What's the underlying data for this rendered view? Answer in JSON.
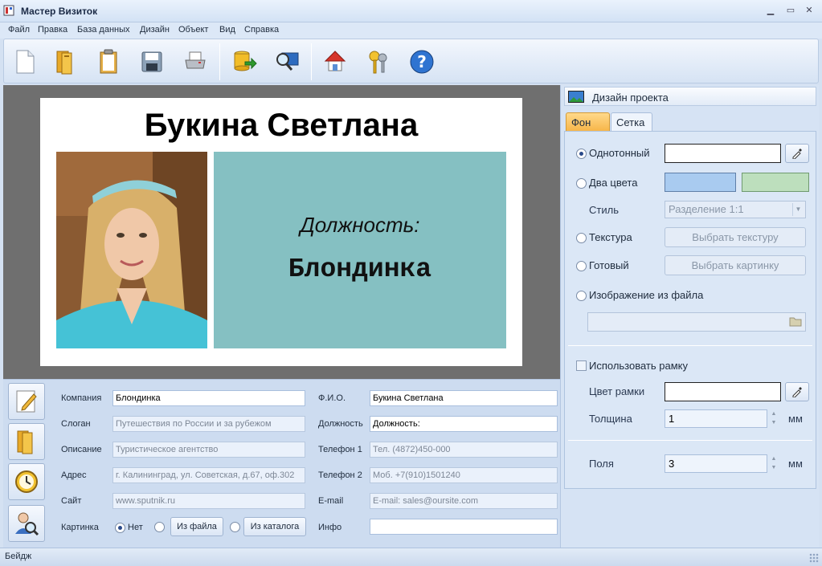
{
  "window": {
    "title": "Мастер Визиток"
  },
  "menu": [
    "Файл",
    "Правка",
    "База данных",
    "Дизайн",
    "Объект",
    "Вид",
    "Справка"
  ],
  "toolbar": {
    "icons": [
      "new-document-icon",
      "open-folder-icon",
      "clipboard-icon",
      "save-icon",
      "print-icon",
      "database-export-icon",
      "preview-monitor-icon",
      "home-icon",
      "keys-icon",
      "help-icon"
    ]
  },
  "card": {
    "name": "Букина Светлана",
    "position_label": "Должность:",
    "position_value": "Блондинка",
    "background": "#85c0c2"
  },
  "form": {
    "labels": {
      "company": "Компания",
      "slogan": "Слоган",
      "description": "Описание",
      "address": "Адрес",
      "site": "Сайт",
      "picture": "Картинка",
      "fio": "Ф.И.О.",
      "position": "Должность",
      "phone1": "Телефон 1",
      "phone2": "Телефон 2",
      "email": "E-mail",
      "info": "Инфо"
    },
    "values": {
      "company": "Блондинка",
      "slogan": "Путешествия по России и за рубежом",
      "description": "Туристическое агентство",
      "address": "г. Калининград, ул. Советская, д.67, оф.302",
      "site": "www.sputnik.ru",
      "fio": "Букина Светлана",
      "position": "Должность:",
      "phone1": "Тел. (4872)450-000",
      "phone2": "Моб. +7(910)1501240",
      "email": "E-mail: sales@oursite.com",
      "info": ""
    },
    "picture_options": {
      "none": "Нет",
      "from_file": "Из файла",
      "from_catalog": "Из каталога"
    }
  },
  "panel": {
    "title": "Дизайн проекта",
    "tabs": [
      "Фон",
      "Сетка"
    ],
    "solid": "Однотонный",
    "two_colors": "Два цвета",
    "style_label": "Стиль",
    "style_value": "Разделение 1:1",
    "texture": "Текстура",
    "texture_button": "Выбрать текстуру",
    "ready": "Готовый",
    "ready_button": "Выбрать картинку",
    "image_file": "Изображение из файла",
    "use_frame": "Использовать рамку",
    "frame_color": "Цвет рамки",
    "thickness": "Толщина",
    "thickness_value": "1",
    "margins": "Поля",
    "margins_value": "3",
    "unit": "мм",
    "colors": {
      "solid": "#ffffff",
      "color1": "#a9cbf0",
      "color2": "#bddfbd",
      "frame": "#ffffff"
    }
  },
  "status": {
    "text": "Бейдж"
  }
}
